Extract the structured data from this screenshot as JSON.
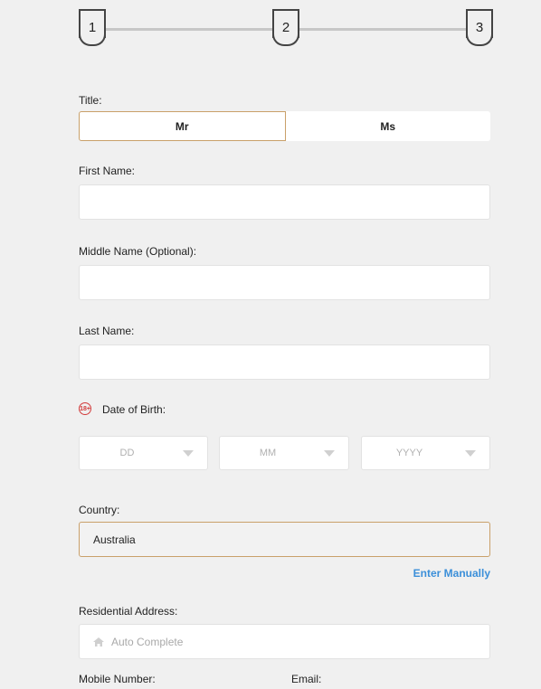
{
  "stepper": {
    "steps": [
      "1",
      "2",
      "3"
    ],
    "current": 1
  },
  "title": {
    "label": "Title:",
    "options": [
      "Mr",
      "Ms"
    ],
    "selected": "Mr"
  },
  "first_name": {
    "label": "First Name:",
    "value": ""
  },
  "middle_name": {
    "label": "Middle Name (Optional):",
    "value": ""
  },
  "last_name": {
    "label": "Last Name:",
    "value": ""
  },
  "dob": {
    "badge": "18+",
    "label": "Date of Birth:",
    "day_placeholder": "DD",
    "month_placeholder": "MM",
    "year_placeholder": "YYYY"
  },
  "country": {
    "label": "Country:",
    "value": "Australia"
  },
  "enter_manually": "Enter Manually",
  "address": {
    "label": "Residential Address:",
    "placeholder": "Auto Complete"
  },
  "mobile": {
    "label": "Mobile Number:"
  },
  "email": {
    "label": "Email:"
  },
  "colors": {
    "background": "#f0f0f0",
    "accent_border": "#c9a06a",
    "link": "#3b8fd9",
    "age_badge": "#d23b3b"
  }
}
